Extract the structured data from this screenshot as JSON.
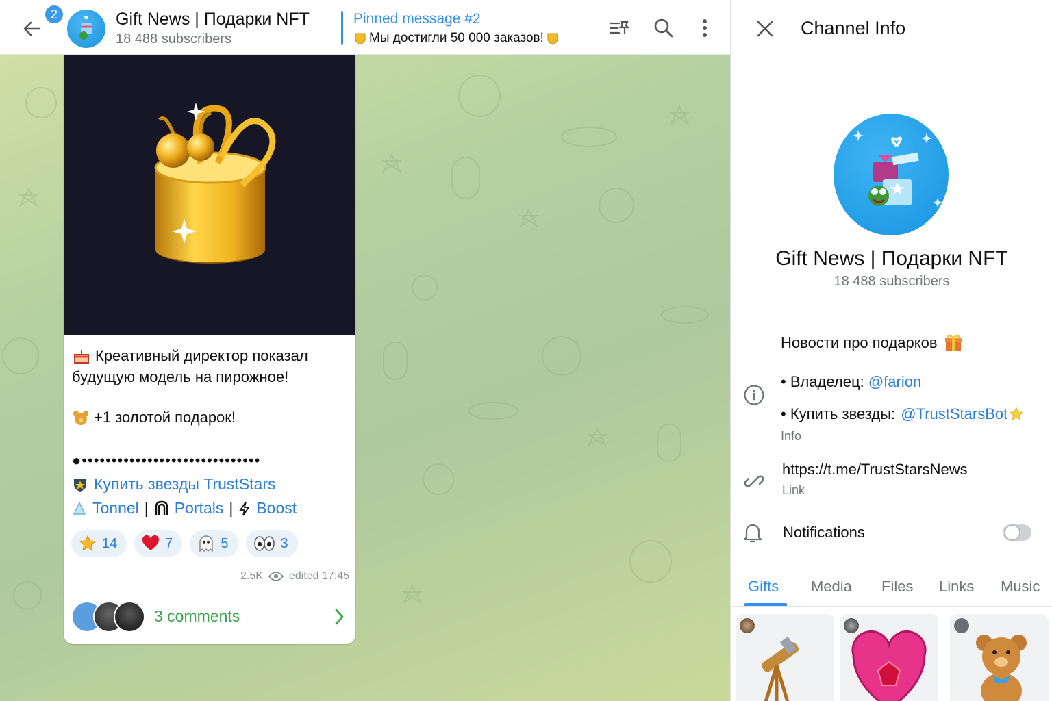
{
  "header": {
    "unread_count": "2",
    "channel_title": "Gift News | Подарки NFT",
    "channel_subscribers": "18 488 subscribers",
    "pinned_title": "Pinned message #2",
    "pinned_text": "Мы достигли 50 000 заказов!"
  },
  "message": {
    "line1": "Креативный директор показал",
    "line2": "будущую модель на пирожное!",
    "line3": "+1 золотой подарок!",
    "dots": "●••••••••••••••••••••••••••••••",
    "link_truststars": "Купить звезды TrustStars",
    "link_tonnel": "Tonnel",
    "separator": "|",
    "link_portals": "Portals",
    "link_boost": "Boost",
    "reactions": [
      {
        "emoji": "star",
        "count": "14"
      },
      {
        "emoji": "heart",
        "count": "7"
      },
      {
        "emoji": "ghost",
        "count": "5"
      },
      {
        "emoji": "eyes",
        "count": "3"
      }
    ],
    "views": "2.5K",
    "edited": "edited 17:45",
    "comments": "3 comments"
  },
  "panel": {
    "title": "Channel Info",
    "name": "Gift News | Подарки NFT",
    "subscribers": "18 488 subscribers",
    "description": "Новости про подарков",
    "owner_prefix": "• Владелец: ",
    "owner_handle": "@farion",
    "buy_prefix": "• Купить звезды: ",
    "buy_handle": "@TrustStarsBot",
    "info_label": "Info",
    "link_url": "https://t.me/TrustStarsNews",
    "link_label": "Link",
    "notifications_label": "Notifications",
    "notifications_on": false,
    "tabs": [
      "Gifts",
      "Media",
      "Files",
      "Links",
      "Music"
    ],
    "active_tab": "Gifts"
  },
  "colors": {
    "accent": "#3390ec",
    "link": "#2c7fd6",
    "comments_green": "#3aa44a",
    "badge": "#3b9ae8"
  }
}
